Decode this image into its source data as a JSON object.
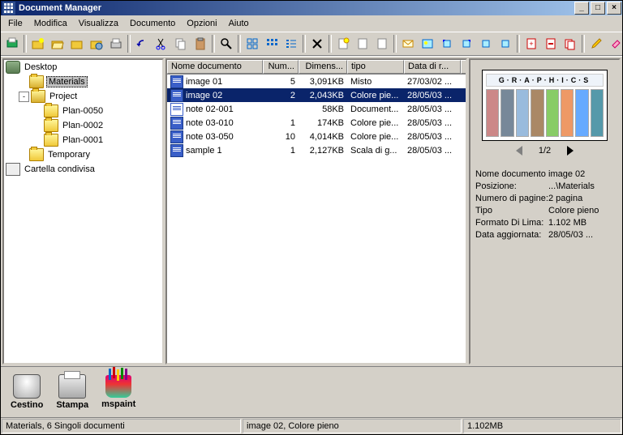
{
  "window": {
    "title": "Document Manager"
  },
  "menu": [
    "File",
    "Modifica",
    "Visualizza",
    "Documento",
    "Opzioni",
    "Aiuto"
  ],
  "tree": {
    "root": "Desktop",
    "items": [
      {
        "depth": 1,
        "exp": null,
        "icon": "folder-open",
        "label": "Materials",
        "sel": true
      },
      {
        "depth": 1,
        "exp": "-",
        "icon": "folder-open",
        "label": "Project"
      },
      {
        "depth": 2,
        "exp": null,
        "icon": "folder",
        "label": "Plan-0050"
      },
      {
        "depth": 2,
        "exp": null,
        "icon": "folder",
        "label": "Plan-0002"
      },
      {
        "depth": 2,
        "exp": null,
        "icon": "folder",
        "label": "Plan-0001"
      },
      {
        "depth": 1,
        "exp": null,
        "icon": "folder",
        "label": "Temporary"
      }
    ],
    "shared": "Cartella condivisa"
  },
  "list": {
    "columns": [
      "Nome documento",
      "Num...",
      "Dimens...",
      "tipo",
      "Data di r..."
    ],
    "rows": [
      {
        "icon": "doc",
        "name": "image 01",
        "num": "5",
        "dim": "3,091KB",
        "tipo": "Misto",
        "date": "27/03/02 ...",
        "sel": false
      },
      {
        "icon": "doc",
        "name": "image 02",
        "num": "2",
        "dim": "2,043KB",
        "tipo": "Colore pie...",
        "date": "28/05/03 ...",
        "sel": true
      },
      {
        "icon": "word",
        "name": "note 02-001",
        "num": "",
        "dim": "58KB",
        "tipo": "Document...",
        "date": "28/05/03 ..."
      },
      {
        "icon": "doc",
        "name": "note 03-010",
        "num": "1",
        "dim": "174KB",
        "tipo": "Colore pie...",
        "date": "28/05/03 ..."
      },
      {
        "icon": "doc",
        "name": "note 03-050",
        "num": "10",
        "dim": "4,014KB",
        "tipo": "Colore pie...",
        "date": "28/05/03 ..."
      },
      {
        "icon": "doc",
        "name": "sample 1",
        "num": "1",
        "dim": "2,127KB",
        "tipo": "Scala di g...",
        "date": "28/05/03 ..."
      }
    ]
  },
  "preview": {
    "thumb_title": "G·R·A·P·H·I·C·S",
    "pager": "1/2",
    "props": [
      {
        "k": "Nome documento",
        "v": "image 02"
      },
      {
        "k": "Posizione:",
        "v": "...\\Materials"
      },
      {
        "k": "Numero di pagine:",
        "v": "2 pagina"
      },
      {
        "k": "Tipo",
        "v": "Colore pieno"
      },
      {
        "k": "Formato Di Lima:",
        "v": "1.102 MB"
      },
      {
        "k": "Data aggiornata:",
        "v": "28/05/03 ..."
      }
    ]
  },
  "launch": [
    {
      "label": "Cestino",
      "icon": "trash"
    },
    {
      "label": "Stampa",
      "icon": "printer"
    },
    {
      "label": "mspaint",
      "icon": "paint"
    }
  ],
  "status": {
    "s1": "Materials, 6 Singoli documenti",
    "s2": "image 02, Colore pieno",
    "s3": "1.102MB"
  }
}
